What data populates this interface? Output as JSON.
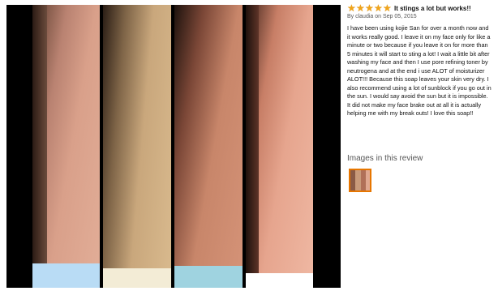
{
  "viewer": {
    "photos": [
      {
        "name": "photo-1",
        "skin": "#d9a08a",
        "band": "#b9dcf5"
      },
      {
        "name": "photo-2",
        "skin": "#c9a77c",
        "band": "#f3ecd6"
      },
      {
        "name": "photo-3",
        "skin": "#c8866a",
        "band": "#9fd3e0"
      },
      {
        "name": "photo-4",
        "skin": "#e6a58e",
        "band": "#ffffff"
      }
    ]
  },
  "review": {
    "rating": 5,
    "star_glyph": "★",
    "title": "It stings a lot but works!!",
    "byline": "By claudia on Sep 05, 2015",
    "body": "I have been using kojie San for over a month now and it works really good. I leave it on my face only for like a minute or two because if you leave it on for more than 5 minutes it will start to sting a lot! I wait a little bit after washing my face and then I use pore refining toner by neutrogena and at the end i use ALOT of moisturizer ALOT!!! Because this soap leaves your skin very dry. I also recommend using a lot of sunblock if you go out in the sun. I would say avoid the sun but it is impossible. It did not make my face brake out at all it is actually helping me with my break outs! I love this soap!!",
    "images_heading": "Images in this review",
    "accent": "#f0a419",
    "thumb_border": "#e77600"
  }
}
